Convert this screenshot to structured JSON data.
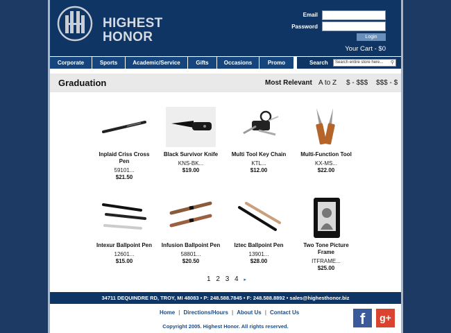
{
  "header": {
    "logo_text_line1": "HIGHEST",
    "logo_text_line2": "HONOR",
    "email_label": "Email",
    "password_label": "Password",
    "login_button": "Login",
    "cart": "Your Cart - $0"
  },
  "nav": {
    "items": [
      "Corporate",
      "Sports",
      "Academic/Service",
      "Gifts",
      "Occasions",
      "Promo"
    ],
    "search_label": "Search",
    "search_placeholder": "Search entire store here..."
  },
  "title_bar": {
    "title": "Graduation",
    "sort_relevant": "Most Relevant",
    "sort_az": "A to Z",
    "sort_low_high": "$ - $$$",
    "sort_high_low": "$$$ - $"
  },
  "products": [
    {
      "name": "Inplaid Criss Cross Pen",
      "sku": "59101...",
      "price": "$21.50",
      "icon": "pen-icon"
    },
    {
      "name": "Black Survivor Knife",
      "sku": "KNS-BK...",
      "price": "$19.00",
      "icon": "knife-icon"
    },
    {
      "name": "Multi Tool Key Chain",
      "sku": "KTL...",
      "price": "$12.00",
      "icon": "keychain-tool-icon"
    },
    {
      "name": "Multi-Function Tool",
      "sku": "KX-MS...",
      "price": "$22.00",
      "icon": "multitool-icon"
    },
    {
      "name": "Intexur Ballpoint Pen",
      "sku": "12601...",
      "price": "$15.00",
      "icon": "pens-icon"
    },
    {
      "name": "Infusion Ballpoint Pen",
      "sku": "58801...",
      "price": "$20.50",
      "icon": "pens-icon"
    },
    {
      "name": "Iztec Ballpoint Pen",
      "sku": "13901...",
      "price": "$28.00",
      "icon": "pens-icon"
    },
    {
      "name": "Two Tone Picture Frame",
      "sku": "ITFRAME...",
      "price": "$25.00",
      "icon": "frame-icon"
    }
  ],
  "pagination": {
    "pages": [
      "1",
      "2",
      "3",
      "4"
    ],
    "next": "▸"
  },
  "footer": {
    "contact": "34711 DEQUINDRE RD, TROY, MI 48083   •   P: 248.588.7845   •   F: 248.588.8892   •   sales@highesthonor.biz",
    "links": [
      "Home",
      "Directions/Hours",
      "About Us",
      "Contact Us"
    ],
    "copyright": "Copyright 2005. Highest Honor. All rights reserved.",
    "facebook": "f",
    "googleplus": "g+"
  },
  "colors": {
    "background": "#1c3a64",
    "header": "#0f3564",
    "nav": "#16457e",
    "link": "#1c4b86"
  }
}
